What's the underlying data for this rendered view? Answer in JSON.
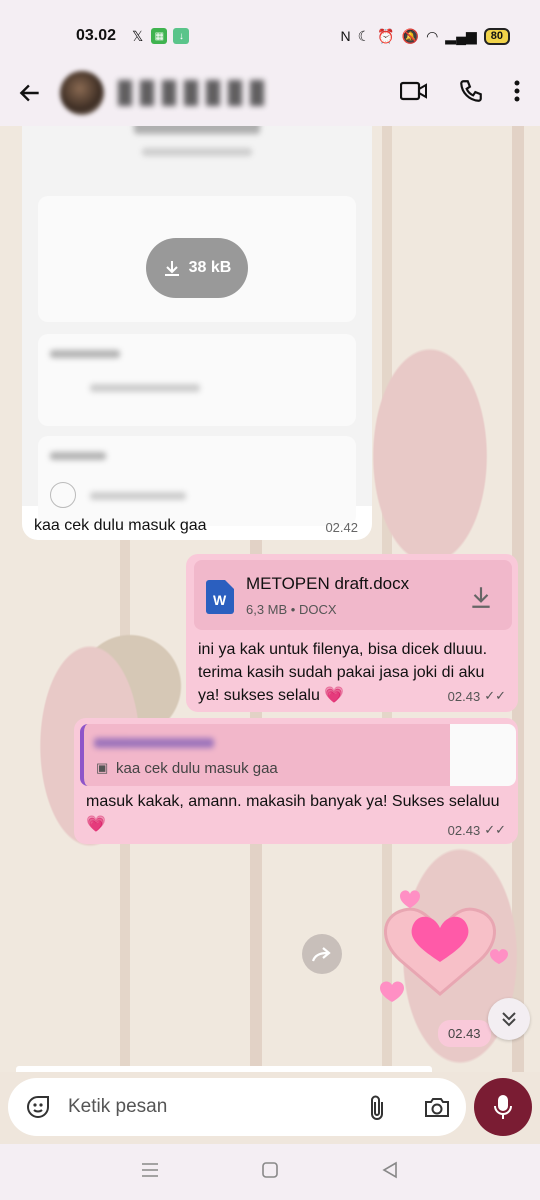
{
  "status_bar": {
    "time": "03.02",
    "battery": "80"
  },
  "header": {
    "contact_name": "(hidden)"
  },
  "incoming": {
    "file_size": "38 kB",
    "card_section_1": "Dikirim Dari",
    "card_section_2": "Kirim Ke",
    "text": "kaa cek dulu masuk gaa",
    "time": "02.42"
  },
  "outgoing_doc": {
    "file_name": "METOPEN draft.docx",
    "file_meta": "6,3 MB • DOCX",
    "text": "ini ya kak untuk filenya, bisa dicek dluuu. terima kasih sudah pakai jasa joki di aku ya! sukses selalu 💗",
    "time": "02.43"
  },
  "outgoing_reply": {
    "quoted_text": "kaa cek dulu masuk gaa",
    "text": "masuk kakak, amann. makasih banyak ya! Sukses selaluu 💗",
    "time": "02.43"
  },
  "sticker_msg": {
    "time": "02.43"
  },
  "composer": {
    "placeholder": "Ketik pesan"
  },
  "colors": {
    "outgoing_bubble": "#f9c9d9",
    "mic_button": "#7a1c33",
    "reply_bar": "#8e55c9"
  }
}
